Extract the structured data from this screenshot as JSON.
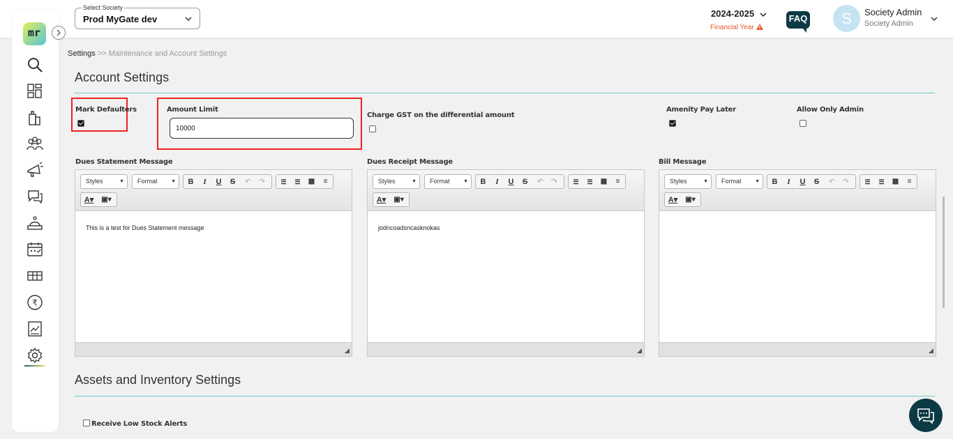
{
  "header": {
    "society_label": "Select Society",
    "society_value": "Prod MyGate dev",
    "fy_value": "2024-2025",
    "fy_sub": "Financial Year",
    "faq": "FAQ",
    "avatar_letter": "S",
    "user_name": "Society Admin",
    "user_role": "Society Admin"
  },
  "logo_text": "mr",
  "breadcrumb": {
    "root": "Settings",
    "rest": ">> Maintenance and Account Settings"
  },
  "account": {
    "title": "Account Settings",
    "mark_defaulters_label": "Mark Defaulters",
    "mark_defaulters_checked": true,
    "amount_limit_label": "Amount Limit",
    "amount_limit_value": "10000",
    "charge_gst_label": "Charge GST on the differential amount",
    "charge_gst_checked": false,
    "amenity_label": "Amenity Pay Later",
    "amenity_checked": true,
    "allow_admin_label": "Allow Only Admin",
    "allow_admin_checked": false
  },
  "editors": {
    "styles_label": "Styles",
    "format_label": "Format",
    "dues_statement": {
      "label": "Dues Statement Message",
      "content": "This is a test for Dues Statement message"
    },
    "dues_receipt": {
      "label": "Dues Receipt Message",
      "content": "jodncoadsncasknokas"
    },
    "bill": {
      "label": "Bill Message",
      "content": ""
    }
  },
  "assets": {
    "title": "Assets and Inventory Settings",
    "low_stock_label": "Receive Low Stock Alerts",
    "low_stock_checked": false
  },
  "colors": {
    "brand_dark": "#0b3a45",
    "accent_teal": "#6ec7c9",
    "warning": "#e8562a",
    "highlight": "#e22222"
  },
  "nav_icons": [
    "search-icon",
    "dashboard-icon",
    "building-icon",
    "residents-icon",
    "notice-icon",
    "chat-icon",
    "helpdesk-icon",
    "calendar-icon",
    "amenity-icon",
    "rupee-icon",
    "report-icon",
    "settings-icon"
  ]
}
